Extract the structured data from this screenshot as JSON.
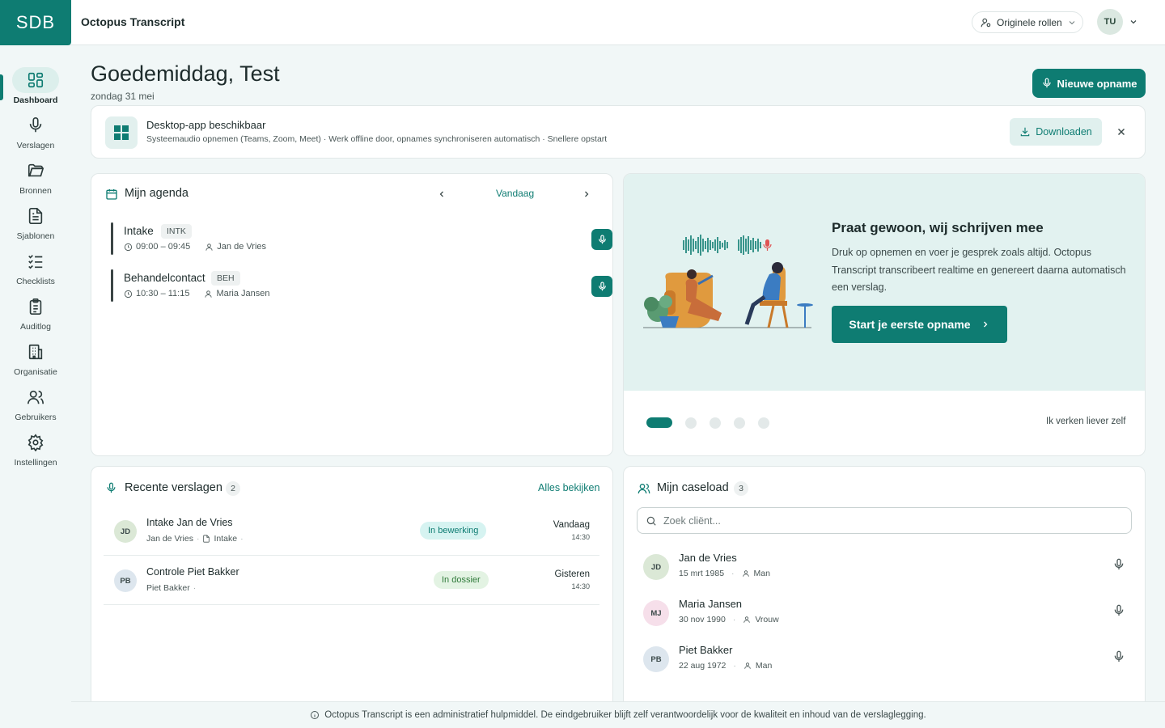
{
  "app": {
    "logo": "SDB",
    "title": "Octopus Transcript"
  },
  "topbar": {
    "role_label": "Originele rollen",
    "user_initials": "TU"
  },
  "sidebar": {
    "items": [
      {
        "label": "Dashboard",
        "icon": "dashboard-icon",
        "active": true
      },
      {
        "label": "Verslagen",
        "icon": "mic-icon"
      },
      {
        "label": "Bronnen",
        "icon": "folder-icon"
      },
      {
        "label": "Sjablonen",
        "icon": "document-icon"
      },
      {
        "label": "Checklists",
        "icon": "checklist-icon"
      },
      {
        "label": "Auditlog",
        "icon": "clipboard-icon"
      },
      {
        "label": "Organisatie",
        "icon": "building-icon"
      },
      {
        "label": "Gebruikers",
        "icon": "users-icon"
      },
      {
        "label": "Instellingen",
        "icon": "gear-icon"
      }
    ]
  },
  "header": {
    "greeting": "Goedemiddag, Test",
    "date": "zondag 31 mei",
    "new_recording_label": "Nieuwe opname"
  },
  "banner": {
    "title": "Desktop-app beschikbaar",
    "description": "Systeemaudio opnemen (Teams, Zoom, Meet) · Werk offline door, opnames synchroniseren automatisch · Snellere opstart",
    "download_label": "Downloaden"
  },
  "agenda": {
    "title": "Mijn agenda",
    "today_label": "Vandaag",
    "appointments": [
      {
        "title": "Intake",
        "tag": "INTK",
        "time": "09:00 – 09:45",
        "client": "Jan de Vries"
      },
      {
        "title": "Behandelcontact",
        "tag": "BEH",
        "time": "10:30 – 11:15",
        "client": "Maria Jansen"
      }
    ]
  },
  "promo": {
    "title": "Praat gewoon, wij schrijven mee",
    "text": "Druk op opnemen en voer je gesprek zoals altijd. Octopus Transcript transcribeert realtime en genereert daarna automatisch een verslag.",
    "button_label": "Start je eerste opname",
    "skip_label": "Ik verken liever zelf",
    "slide_count": 5,
    "active_slide": 1
  },
  "recent": {
    "title": "Recente verslagen",
    "count": "2",
    "see_all_label": "Alles bekijken",
    "reports": [
      {
        "initials": "JD",
        "title": "Intake Jan de Vries",
        "client": "Jan de Vries",
        "template": "Intake",
        "status": "In bewerking",
        "day": "Vandaag",
        "time": "14:30"
      },
      {
        "initials": "PB",
        "title": "Controle Piet Bakker",
        "client": "Piet Bakker",
        "template": "",
        "status": "In dossier",
        "day": "Gisteren",
        "time": "14:30"
      }
    ]
  },
  "caseload": {
    "title": "Mijn caseload",
    "count": "3",
    "search_placeholder": "Zoek cliënt...",
    "clients": [
      {
        "initials": "JD",
        "name": "Jan de Vries",
        "dob": "15 mrt 1985",
        "gender": "Man"
      },
      {
        "initials": "MJ",
        "name": "Maria Jansen",
        "dob": "30 nov 1990",
        "gender": "Vrouw"
      },
      {
        "initials": "PB",
        "name": "Piet Bakker",
        "dob": "22 aug 1972",
        "gender": "Man"
      }
    ]
  },
  "footer": {
    "disclaimer": "Octopus Transcript is een administratief hulpmiddel. De eindgebruiker blijft zelf verantwoordelijk voor de kwaliteit en inhoud van de verslaglegging."
  },
  "colors": {
    "primary": "#0e7c72",
    "accent_light": "#e2f2f0",
    "status_editing": "#d8f3f1",
    "status_dossier": "#e3f3e3"
  }
}
